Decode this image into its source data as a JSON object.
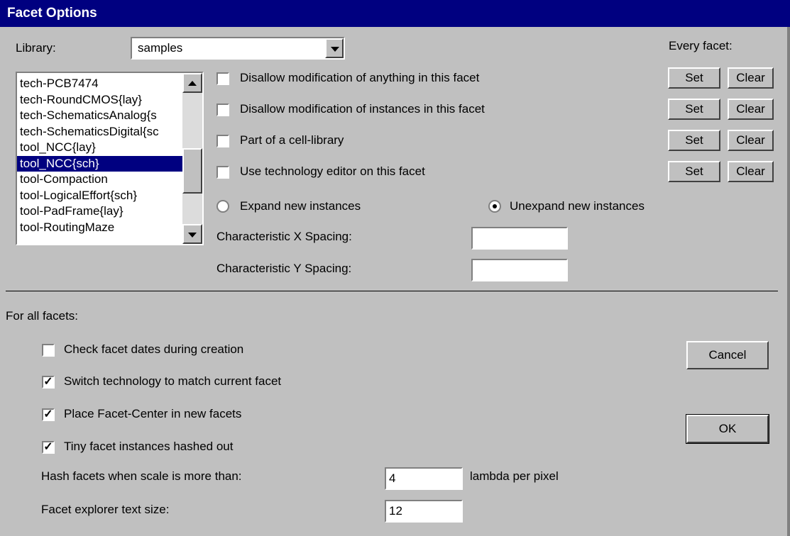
{
  "window": {
    "title": "Facet Options"
  },
  "library": {
    "label": "Library:",
    "value": "samples"
  },
  "every_facet_label": "Every facet:",
  "facet_list": {
    "items": [
      "tech-PCB7474",
      "tech-RoundCMOS{lay}",
      "tech-SchematicsAnalog{s",
      "tech-SchematicsDigital{sc",
      "tool_NCC{lay}",
      "tool_NCC{sch}",
      "tool-Compaction",
      "tool-LogicalEffort{sch}",
      "tool-PadFrame{lay}",
      "tool-RoutingMaze"
    ],
    "selected": "tool_NCC{sch}"
  },
  "facet_options": [
    {
      "label": "Disallow modification of anything in this facet",
      "checked": false,
      "set": "Set",
      "clear": "Clear"
    },
    {
      "label": "Disallow modification of instances in this facet",
      "checked": false,
      "set": "Set",
      "clear": "Clear"
    },
    {
      "label": "Part of a cell-library",
      "checked": false,
      "set": "Set",
      "clear": "Clear"
    },
    {
      "label": "Use technology editor on this facet",
      "checked": false,
      "set": "Set",
      "clear": "Clear"
    }
  ],
  "expand": {
    "expand_label": "Expand new instances",
    "unexpand_label": "Unexpand new instances",
    "selected": "unexpand"
  },
  "spacing": {
    "x_label": "Characteristic X Spacing:",
    "x_value": "",
    "y_label": "Characteristic Y Spacing:",
    "y_value": ""
  },
  "all_facets": {
    "heading": "For all facets:",
    "options": [
      {
        "label": "Check facet dates during creation",
        "checked": false
      },
      {
        "label": "Switch technology to match current facet",
        "checked": true
      },
      {
        "label": "Place Facet-Center in new facets",
        "checked": true
      },
      {
        "label": "Tiny facet instances hashed out",
        "checked": true
      }
    ],
    "hash_label": "Hash facets when scale is more than:",
    "hash_value": "4",
    "hash_unit": "lambda per pixel",
    "text_size_label": "Facet explorer text size:",
    "text_size_value": "12"
  },
  "buttons": {
    "cancel": "Cancel",
    "ok": "OK"
  }
}
